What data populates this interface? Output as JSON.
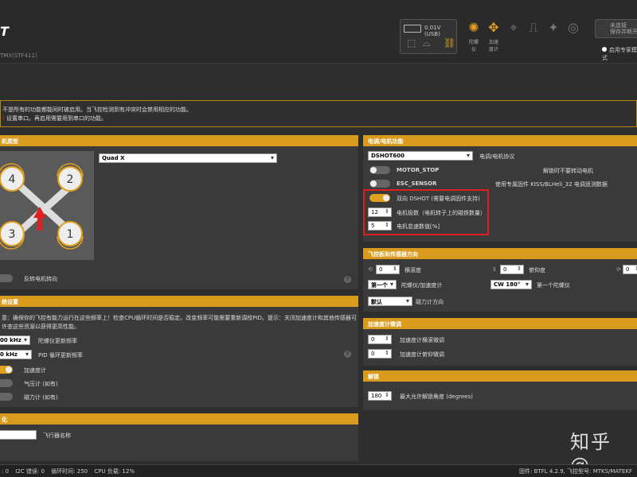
{
  "header": {
    "logo": "T",
    "firmware": "TMX(STF411)",
    "battery_voltage": "0.01V (USB)",
    "toolbar": [
      {
        "label1": "陀螺",
        "label2": "仪",
        "icon": "gyro-icon",
        "color": "#e0a020"
      },
      {
        "label1": "加速",
        "label2": "度计",
        "icon": "accel-icon",
        "color": "#e0a020"
      },
      {
        "label1": "",
        "label2": "",
        "icon": "mag-icon",
        "color": "#777"
      },
      {
        "label1": "",
        "label2": "",
        "icon": "baro-icon",
        "color": "#777"
      },
      {
        "label1": "",
        "label2": "",
        "icon": "gps-icon",
        "color": "#777"
      },
      {
        "label1": "",
        "label2": "",
        "icon": "sonar-icon",
        "color": "#777"
      }
    ],
    "right_button_line1": "未连接",
    "right_button_line2": "保存并断开",
    "expert_mode": "启用专家模式"
  },
  "warning": {
    "line1": "不是所有的功能都能同时被启用。当飞控检测到有冲突时会禁用相应的功能。",
    "line2_pre": "",
    "line2_red": "!",
    "line2_post": "设置串口。再启用需要用到串口的功能。"
  },
  "mixer": {
    "header": "机类型",
    "selected": "Quad X",
    "motors": [
      "4",
      "2",
      "3",
      "1"
    ],
    "reverse_label": "反转电机转向"
  },
  "esc": {
    "header": "电调/电机功能",
    "protocol": "DSHOT600",
    "protocol_label": "电调/电机协议",
    "motor_stop": "MOTOR_STOP",
    "motor_stop_desc": "解锁时不要转动电机",
    "esc_sensor": "ESC_SENSOR",
    "esc_sensor_desc": "使用专属固件 KISS/BLHeli_32 电调遥测数据",
    "bidir": "双向 DSHOT (需要电调固件支持)",
    "poles_value": "12",
    "poles_label": "电机极数（电机转子上的磁铁数量）",
    "idle_value": "5",
    "idle_label": "电机怠速数值[%]"
  },
  "board": {
    "header": "飞控板和传感器方向",
    "roll_value": "0",
    "roll_label": "横滚度",
    "pitch_value": "0",
    "pitch_label": "俯仰度",
    "yaw_value": "0",
    "sel1": "第一个",
    "sel1_label": "陀螺仪/加速度计",
    "sel2": "CW 180°",
    "sel2_label": "第一个陀螺仪",
    "sel3": "默认",
    "sel3_label": "磁力计方向"
  },
  "accel": {
    "header": "加速度计微调",
    "roll_value": "0",
    "roll_label": "加速度计横滚微调",
    "pitch_value": "0",
    "pitch_label": "加速度计俯仰微调"
  },
  "arming": {
    "header": "解锁",
    "value": "180",
    "label": "最大允许解锁角度 (degrees)"
  },
  "system": {
    "header": "统设置",
    "notice": "意：确保你的飞控有能力运行在这些频率上！检查CPU循环时间是否稳定。改变频率可能需要重新调校PID。提示：关闭加速度计和其他传感器可",
    "notice2": "许查这些资源以获得更高性能。",
    "gyro_freq": "00 kHz",
    "gyro_label": "陀螺仪更新频率",
    "pid_freq": "0 kHz",
    "pid_label": "PID 循环更新频率",
    "acc_label": "加速度计",
    "baro_label": "气压计 (如有)",
    "mag_label": "磁力计 (如有)"
  },
  "personal": {
    "header": "化",
    "craft_label": "飞行器名称"
  },
  "status_bar": {
    "items": [
      ": 0",
      "I2C 错误: 0",
      "循环时间: 250",
      "CPU 负载: 12%"
    ],
    "right": "固件: BTFL 4.2.9, 飞控型号: MTKS/MATEKF"
  },
  "watermark": "知乎 @"
}
